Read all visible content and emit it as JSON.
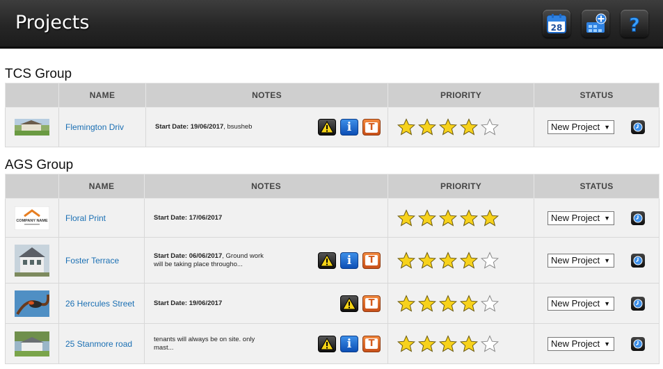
{
  "app": {
    "title": "Projects"
  },
  "header_buttons": {
    "calendar": {
      "label": "28",
      "icon": "calendar-icon"
    },
    "add_project": {
      "icon": "add-project-icon"
    },
    "help": {
      "label": "?",
      "icon": "help-icon"
    }
  },
  "columns": [
    "NAME",
    "NOTES",
    "PRIORITY",
    "STATUS"
  ],
  "groups": [
    {
      "title": "TCS Group",
      "projects": [
        {
          "name": "Flemington Driv",
          "notes_label": "Start Date:",
          "notes_date": "19/06/2017",
          "notes_extra": ", bsusheb",
          "notes_extra2": "",
          "icons": [
            "warning",
            "info",
            "task"
          ],
          "priority": 4,
          "status": "New Project"
        }
      ]
    },
    {
      "title": "AGS Group",
      "projects": [
        {
          "name": "Floral Print",
          "notes_label": "Start Date:",
          "notes_date": "17/06/2017",
          "notes_extra": "",
          "notes_extra2": "",
          "icons": [],
          "priority": 5,
          "status": "New Project",
          "logo_text": "COMPANY NAME"
        },
        {
          "name": "Foster Terrace",
          "notes_label": "Start Date:",
          "notes_date": "06/06/2017",
          "notes_extra": ", Ground work",
          "notes_extra2": "will be taking place througho...",
          "icons": [
            "warning",
            "info",
            "task"
          ],
          "priority": 4,
          "status": "New Project"
        },
        {
          "name": "26 Hercules Street",
          "notes_label": "Start Date:",
          "notes_date": "19/06/2017",
          "notes_extra": "",
          "notes_extra2": "",
          "icons": [
            "warning",
            "task"
          ],
          "priority": 4,
          "status": "New Project"
        },
        {
          "name": "25 Stanmore road",
          "notes_label": "",
          "notes_date": "",
          "notes_extra": "tenants will always be on site. only",
          "notes_extra2": "mast...",
          "icons": [
            "warning",
            "info",
            "task"
          ],
          "priority": 4,
          "status": "New Project"
        }
      ]
    }
  ],
  "max_priority": 5,
  "colors": {
    "link": "#1a6fb3",
    "star_fill": "#f7d21c",
    "header_bg": "#262626",
    "table_header": "#cfcfcf"
  }
}
